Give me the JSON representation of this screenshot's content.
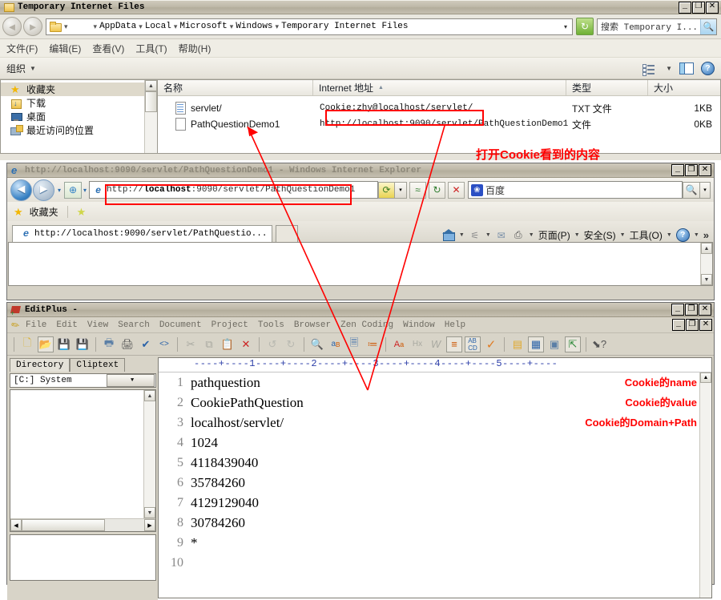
{
  "explorer": {
    "title": "Temporary Internet Files",
    "window_buttons": {
      "minimize": "_",
      "maximize": "❐",
      "close": "✕"
    },
    "breadcrumb": [
      "AppData",
      "Local",
      "Microsoft",
      "Windows",
      "Temporary Internet Files"
    ],
    "refresh_label": "↻",
    "search": {
      "placeholder": "搜索 Temporary I...",
      "icon": "search-icon"
    },
    "menubar": [
      "文件(F)",
      "编辑(E)",
      "查看(V)",
      "工具(T)",
      "帮助(H)"
    ],
    "toolbar": {
      "organize": "组织",
      "caret": "▼",
      "help": "?"
    },
    "nav_pane": [
      {
        "label": "收藏夹",
        "icon": "star-icon",
        "selected": true
      },
      {
        "label": "下载",
        "icon": "download-icon",
        "selected": false
      },
      {
        "label": "桌面",
        "icon": "desktop-icon",
        "selected": false
      },
      {
        "label": "最近访问的位置",
        "icon": "recent-places-icon",
        "selected": false
      }
    ],
    "columns": [
      {
        "label": "名称",
        "sorted": false
      },
      {
        "label": "Internet 地址",
        "sorted": true,
        "sort_arrow": "▲"
      },
      {
        "label": "类型",
        "sorted": false
      },
      {
        "label": "大小",
        "sorted": false
      }
    ],
    "rows": [
      {
        "name": "servlet/",
        "url": "Cookie:zhy@localhost/servlet/",
        "type": "TXT 文件",
        "size": "1KB",
        "highlight": true
      },
      {
        "name": "PathQuestionDemo1",
        "url": "http://localhost:9090/servlet/PathQuestionDemo1",
        "type": "文件",
        "size": "0KB",
        "highlight": false
      }
    ]
  },
  "ie": {
    "title": "http://localhost:9090/servlet/PathQuestionDemo1 - Windows Internet Explorer",
    "window_buttons": {
      "minimize": "_",
      "maximize": "❐",
      "close": "✕"
    },
    "url": "http://localhost:9090/servlet/PathQuestionDemo1",
    "url_host": "localhost",
    "url_prefix": "http://",
    "url_suffix": ":9090/servlet/PathQuestionDemo1",
    "search_engine": "百度",
    "favorites_label": "收藏夹",
    "tab_label": "http://localhost:9090/servlet/PathQuestio...",
    "command_bar": [
      "页面(P)",
      "安全(S)",
      "工具(O)"
    ],
    "overflow": "»"
  },
  "editplus": {
    "title": "EditPlus -",
    "window_buttons": {
      "minimize": "_",
      "maximize": "❐",
      "close": "✕"
    },
    "mdi_buttons": {
      "minimize": "_",
      "restore": "❐",
      "close": "✕"
    },
    "menu": [
      "File",
      "Edit",
      "View",
      "Search",
      "Document",
      "Project",
      "Tools",
      "Browser",
      "Zen Coding",
      "Window",
      "Help"
    ],
    "tabs": [
      {
        "label": "Directory",
        "active": true
      },
      {
        "label": "Cliptext",
        "active": false
      }
    ],
    "drive_combo": "[C:] System",
    "ruler": "----+----1----+----2----+----3----+----4----+----5----+----",
    "lines": [
      {
        "num": "1",
        "text": "pathquestion"
      },
      {
        "num": "2",
        "text": "CookiePathQuestion"
      },
      {
        "num": "3",
        "text": "localhost/servlet/"
      },
      {
        "num": "4",
        "text": "1024"
      },
      {
        "num": "5",
        "text": "4118439040"
      },
      {
        "num": "6",
        "text": "35784260"
      },
      {
        "num": "7",
        "text": "4129129040"
      },
      {
        "num": "8",
        "text": "30784260"
      },
      {
        "num": "9",
        "text": "*"
      },
      {
        "num": "10",
        "text": ""
      }
    ],
    "annotations": [
      "Cookie的name",
      "Cookie的value",
      "Cookie的Domain+Path"
    ]
  },
  "overlay": {
    "callout": "打开Cookie看到的内容",
    "accent_color": "#ff0000"
  }
}
